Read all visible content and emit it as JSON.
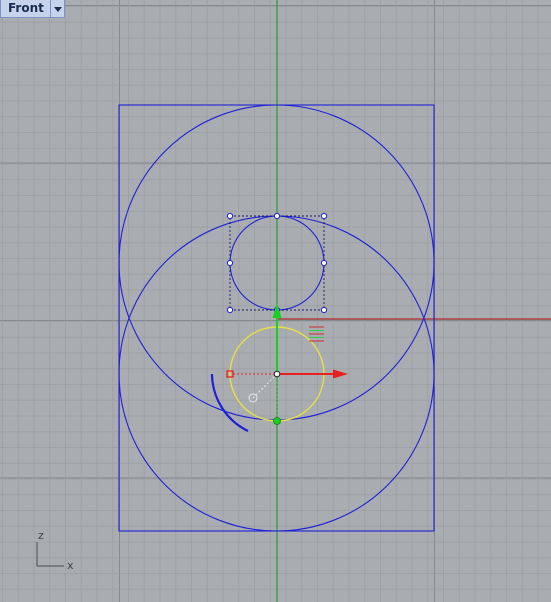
{
  "viewport": {
    "name": "Front",
    "menu_icon": "chevron-down-icon"
  },
  "axis_widget": {
    "vertical_label": "z",
    "horizontal_label": "x"
  },
  "colors": {
    "background": "#a9acb0",
    "grid_minor": "#969a9e",
    "grid_major": "#82858a",
    "curves": "#2020d8",
    "selected_circle": "#e5e048",
    "x_axis": "#a82a2a",
    "y_axis": "#2c9a3a",
    "gumball_x": "#e82020",
    "gumball_z": "#18d020",
    "tab_bg": "#c7d3ec"
  }
}
